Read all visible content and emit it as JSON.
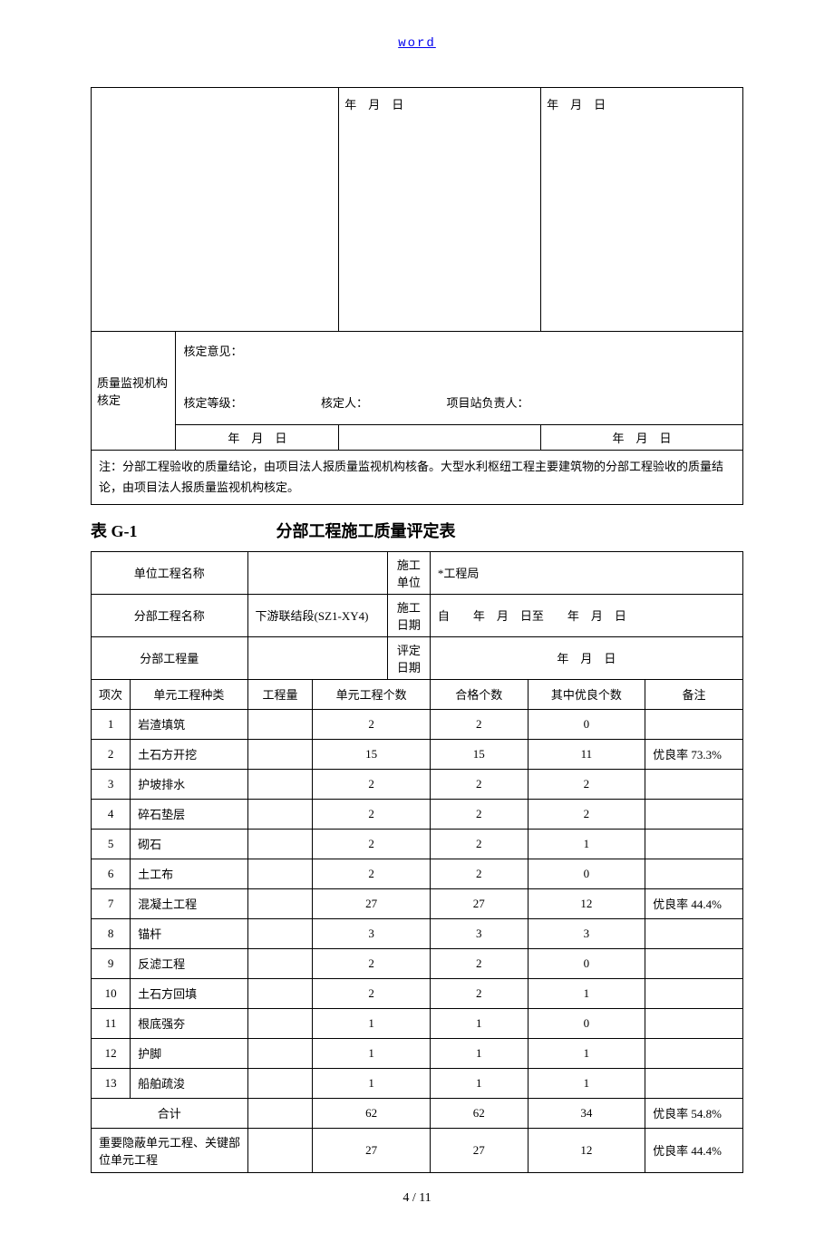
{
  "header_link": "word",
  "top_table": {
    "date_label1": "年　月　日",
    "date_label2": "年　月　日",
    "review_org": "质量监视机构核定",
    "review_opinion": "核定意见：",
    "review_grade": "核定等级：",
    "reviewer": "核定人：",
    "project_lead": "项目站负责人：",
    "date_bottom1": "年　月　日",
    "date_bottom2": "年　月　日",
    "note": "注：分部工程验收的质量结论，由项目法人报质量监视机构核备。大型水利枢纽工程主要建筑物的分部工程验收的质量结论，由项目法人报质量监视机构核定。"
  },
  "title": {
    "table_label": "表 G-1",
    "main": "分部工程施工质量评定表"
  },
  "info": {
    "unit_proj_label": "单位工程名称",
    "unit_proj_value": "",
    "const_unit_label": "施工单位",
    "const_unit_value": "*工程局",
    "sub_proj_label": "分部工程名称",
    "sub_proj_value": "下游联结段(SZ1-XY4)",
    "const_date_label": "施工日期",
    "const_date_value": "自　　年　月　日至　　年　月　日",
    "sub_qty_label": "分部工程量",
    "sub_qty_value": "",
    "eval_date_label": "评定日期",
    "eval_date_value": "年　月　日"
  },
  "headers": {
    "seq": "项次",
    "type": "单元工程种类",
    "qty": "工程量",
    "unit_count": "单元工程个数",
    "pass_count": "合格个数",
    "excellent_count": "其中优良个数",
    "remark": "备注"
  },
  "rows": [
    {
      "seq": "1",
      "type": "岩渣填筑",
      "qty": "",
      "unit_count": "2",
      "pass_count": "2",
      "excellent_count": "0",
      "remark": ""
    },
    {
      "seq": "2",
      "type": "土石方开挖",
      "qty": "",
      "unit_count": "15",
      "pass_count": "15",
      "excellent_count": "11",
      "remark": "优良率 73.3%"
    },
    {
      "seq": "3",
      "type": "护坡排水",
      "qty": "",
      "unit_count": "2",
      "pass_count": "2",
      "excellent_count": "2",
      "remark": ""
    },
    {
      "seq": "4",
      "type": "碎石垫层",
      "qty": "",
      "unit_count": "2",
      "pass_count": "2",
      "excellent_count": "2",
      "remark": ""
    },
    {
      "seq": "5",
      "type": "砌石",
      "qty": "",
      "unit_count": "2",
      "pass_count": "2",
      "excellent_count": "1",
      "remark": ""
    },
    {
      "seq": "6",
      "type": "土工布",
      "qty": "",
      "unit_count": "2",
      "pass_count": "2",
      "excellent_count": "0",
      "remark": ""
    },
    {
      "seq": "7",
      "type": "混凝土工程",
      "qty": "",
      "unit_count": "27",
      "pass_count": "27",
      "excellent_count": "12",
      "remark": "优良率 44.4%"
    },
    {
      "seq": "8",
      "type": "锚杆",
      "qty": "",
      "unit_count": "3",
      "pass_count": "3",
      "excellent_count": "3",
      "remark": ""
    },
    {
      "seq": "9",
      "type": "反滤工程",
      "qty": "",
      "unit_count": "2",
      "pass_count": "2",
      "excellent_count": "0",
      "remark": ""
    },
    {
      "seq": "10",
      "type": "土石方回填",
      "qty": "",
      "unit_count": "2",
      "pass_count": "2",
      "excellent_count": "1",
      "remark": ""
    },
    {
      "seq": "11",
      "type": "根底强夯",
      "qty": "",
      "unit_count": "1",
      "pass_count": "1",
      "excellent_count": "0",
      "remark": ""
    },
    {
      "seq": "12",
      "type": "护脚",
      "qty": "",
      "unit_count": "1",
      "pass_count": "1",
      "excellent_count": "1",
      "remark": ""
    },
    {
      "seq": "13",
      "type": "船舶疏浚",
      "qty": "",
      "unit_count": "1",
      "pass_count": "1",
      "excellent_count": "1",
      "remark": ""
    }
  ],
  "totals": {
    "label": "合计",
    "unit_count": "62",
    "pass_count": "62",
    "excellent_count": "34",
    "remark": "优良率 54.8%"
  },
  "important": {
    "label": "重要隐蔽单元工程、关键部位单元工程",
    "unit_count": "27",
    "pass_count": "27",
    "excellent_count": "12",
    "remark": "优良率 44.4%"
  },
  "footer": "4 / 11"
}
